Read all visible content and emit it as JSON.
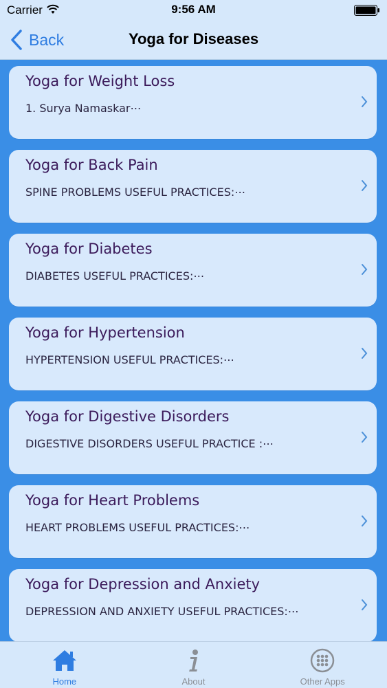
{
  "status": {
    "carrier": "Carrier",
    "time": "9:56 AM"
  },
  "nav": {
    "back_label": "Back",
    "title": "Yoga for Diseases"
  },
  "items": [
    {
      "title": "Yoga for Weight Loss",
      "subtitle": "1. Surya Namaskar⋯"
    },
    {
      "title": "Yoga for Back Pain",
      "subtitle": "SPINE PROBLEMS USEFUL PRACTICES:⋯"
    },
    {
      "title": "Yoga for Diabetes",
      "subtitle": "DIABETES USEFUL PRACTICES:⋯"
    },
    {
      "title": "Yoga for Hypertension",
      "subtitle": "HYPERTENSION USEFUL PRACTICES:⋯"
    },
    {
      "title": "Yoga for Digestive Disorders",
      "subtitle": "DIGESTIVE DISORDERS USEFUL PRACTICE :⋯"
    },
    {
      "title": "Yoga for Heart Problems",
      "subtitle": "HEART PROBLEMS USEFUL PRACTICES:⋯"
    },
    {
      "title": "Yoga for Depression and Anxiety",
      "subtitle": "DEPRESSION AND ANXIETY USEFUL PRACTICES:⋯"
    }
  ],
  "tabs": [
    {
      "label": "Home",
      "icon": "home-icon",
      "active": true
    },
    {
      "label": "About",
      "icon": "info-icon",
      "active": false
    },
    {
      "label": "Other Apps",
      "icon": "grid-icon",
      "active": false
    }
  ],
  "colors": {
    "accent": "#2f7de1",
    "background": "#3a8ee6",
    "card": "#d8e9fc"
  }
}
